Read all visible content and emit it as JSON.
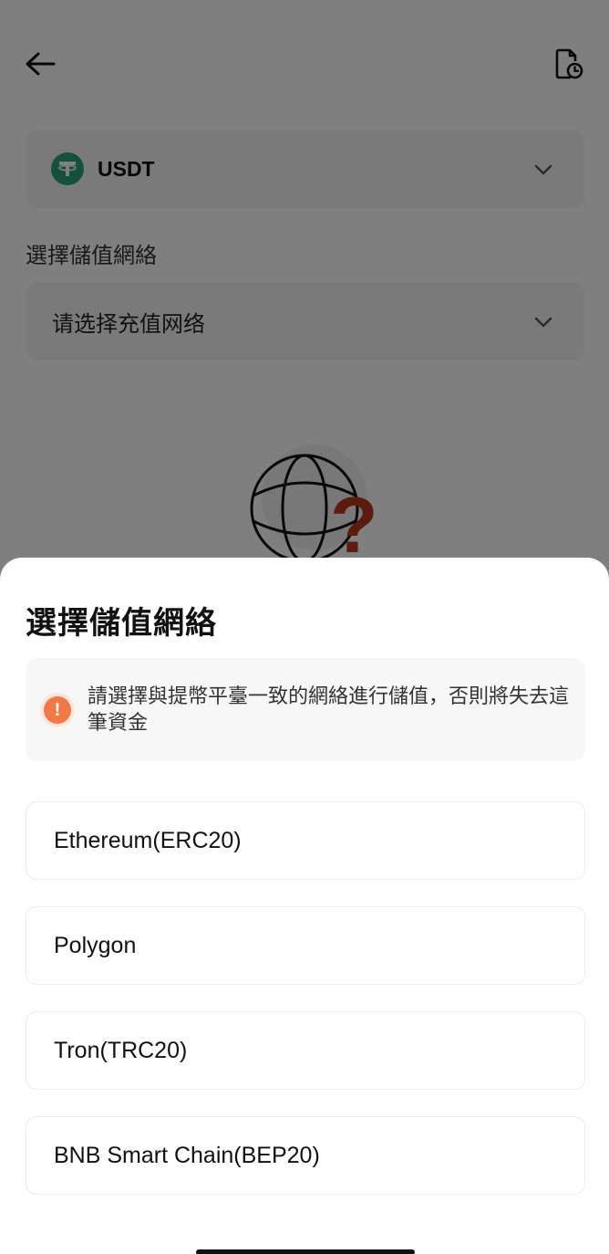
{
  "header": {
    "back_icon": "arrow-left-icon",
    "history_icon": "document-clock-icon"
  },
  "coin_select": {
    "logo_icon": "tether-icon",
    "logo_color": "#26a17b",
    "name": "USDT"
  },
  "network_section": {
    "label": "選擇儲值網絡",
    "placeholder": "请选择充值网络"
  },
  "illustration": {
    "icon": "globe-question-icon",
    "accent": "#b8391b"
  },
  "sheet": {
    "title": "選擇儲值網絡",
    "notice": {
      "icon": "exclamation-icon",
      "color": "#f07945",
      "text": "請選擇與提幣平臺一致的網絡進行儲值，否則將失去這筆資金"
    },
    "networks": [
      {
        "label": "Ethereum(ERC20)"
      },
      {
        "label": "Polygon"
      },
      {
        "label": "Tron(TRC20)"
      },
      {
        "label": "BNB Smart Chain(BEP20)"
      }
    ]
  }
}
